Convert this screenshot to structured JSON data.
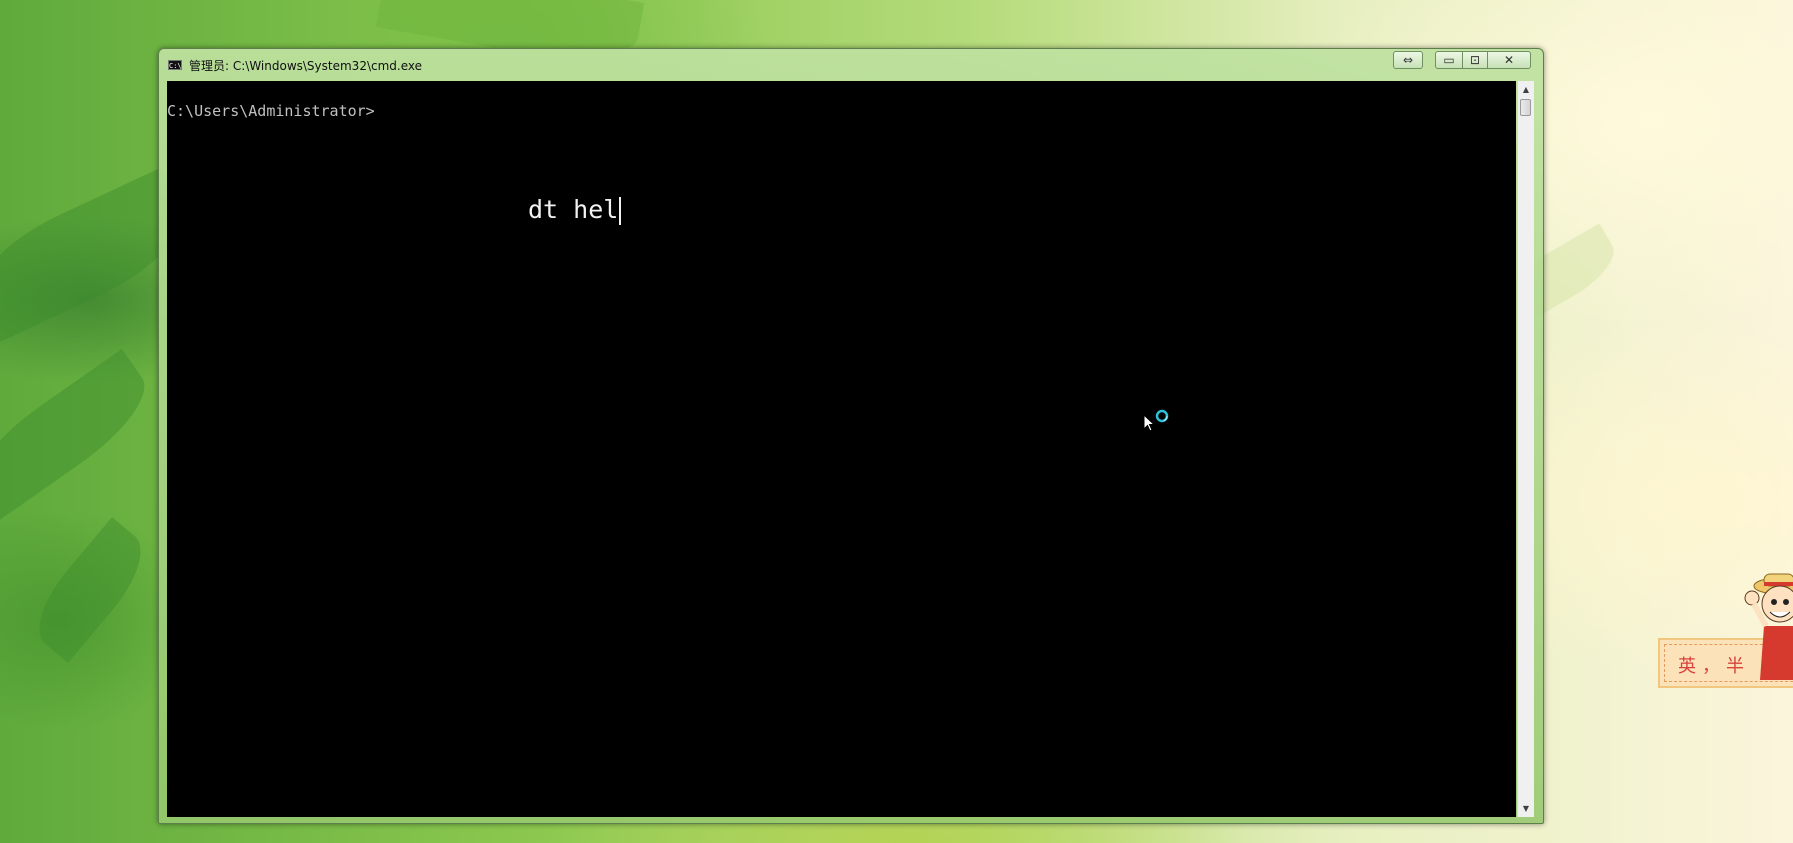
{
  "window": {
    "title": "管理员: C:\\Windows\\System32\\cmd.exe",
    "icon": "cmd-icon",
    "icon_text": "C:\\"
  },
  "caption_buttons": {
    "resize_glyph": "⇔",
    "minimize_glyph": "▭",
    "maximize_glyph": "⊡",
    "close_glyph": "✕"
  },
  "console": {
    "prompt": "C:\\Users\\Administrator>",
    "typed_text": "dt hel",
    "background": "#000000",
    "foreground": "#c0c0c0"
  },
  "scrollbar": {
    "up_glyph": "▲",
    "down_glyph": "▼"
  },
  "ime": {
    "label": "英，半",
    "icon": "mascot-icon"
  },
  "cursor": {
    "icon": "busy-cursor-icon"
  }
}
